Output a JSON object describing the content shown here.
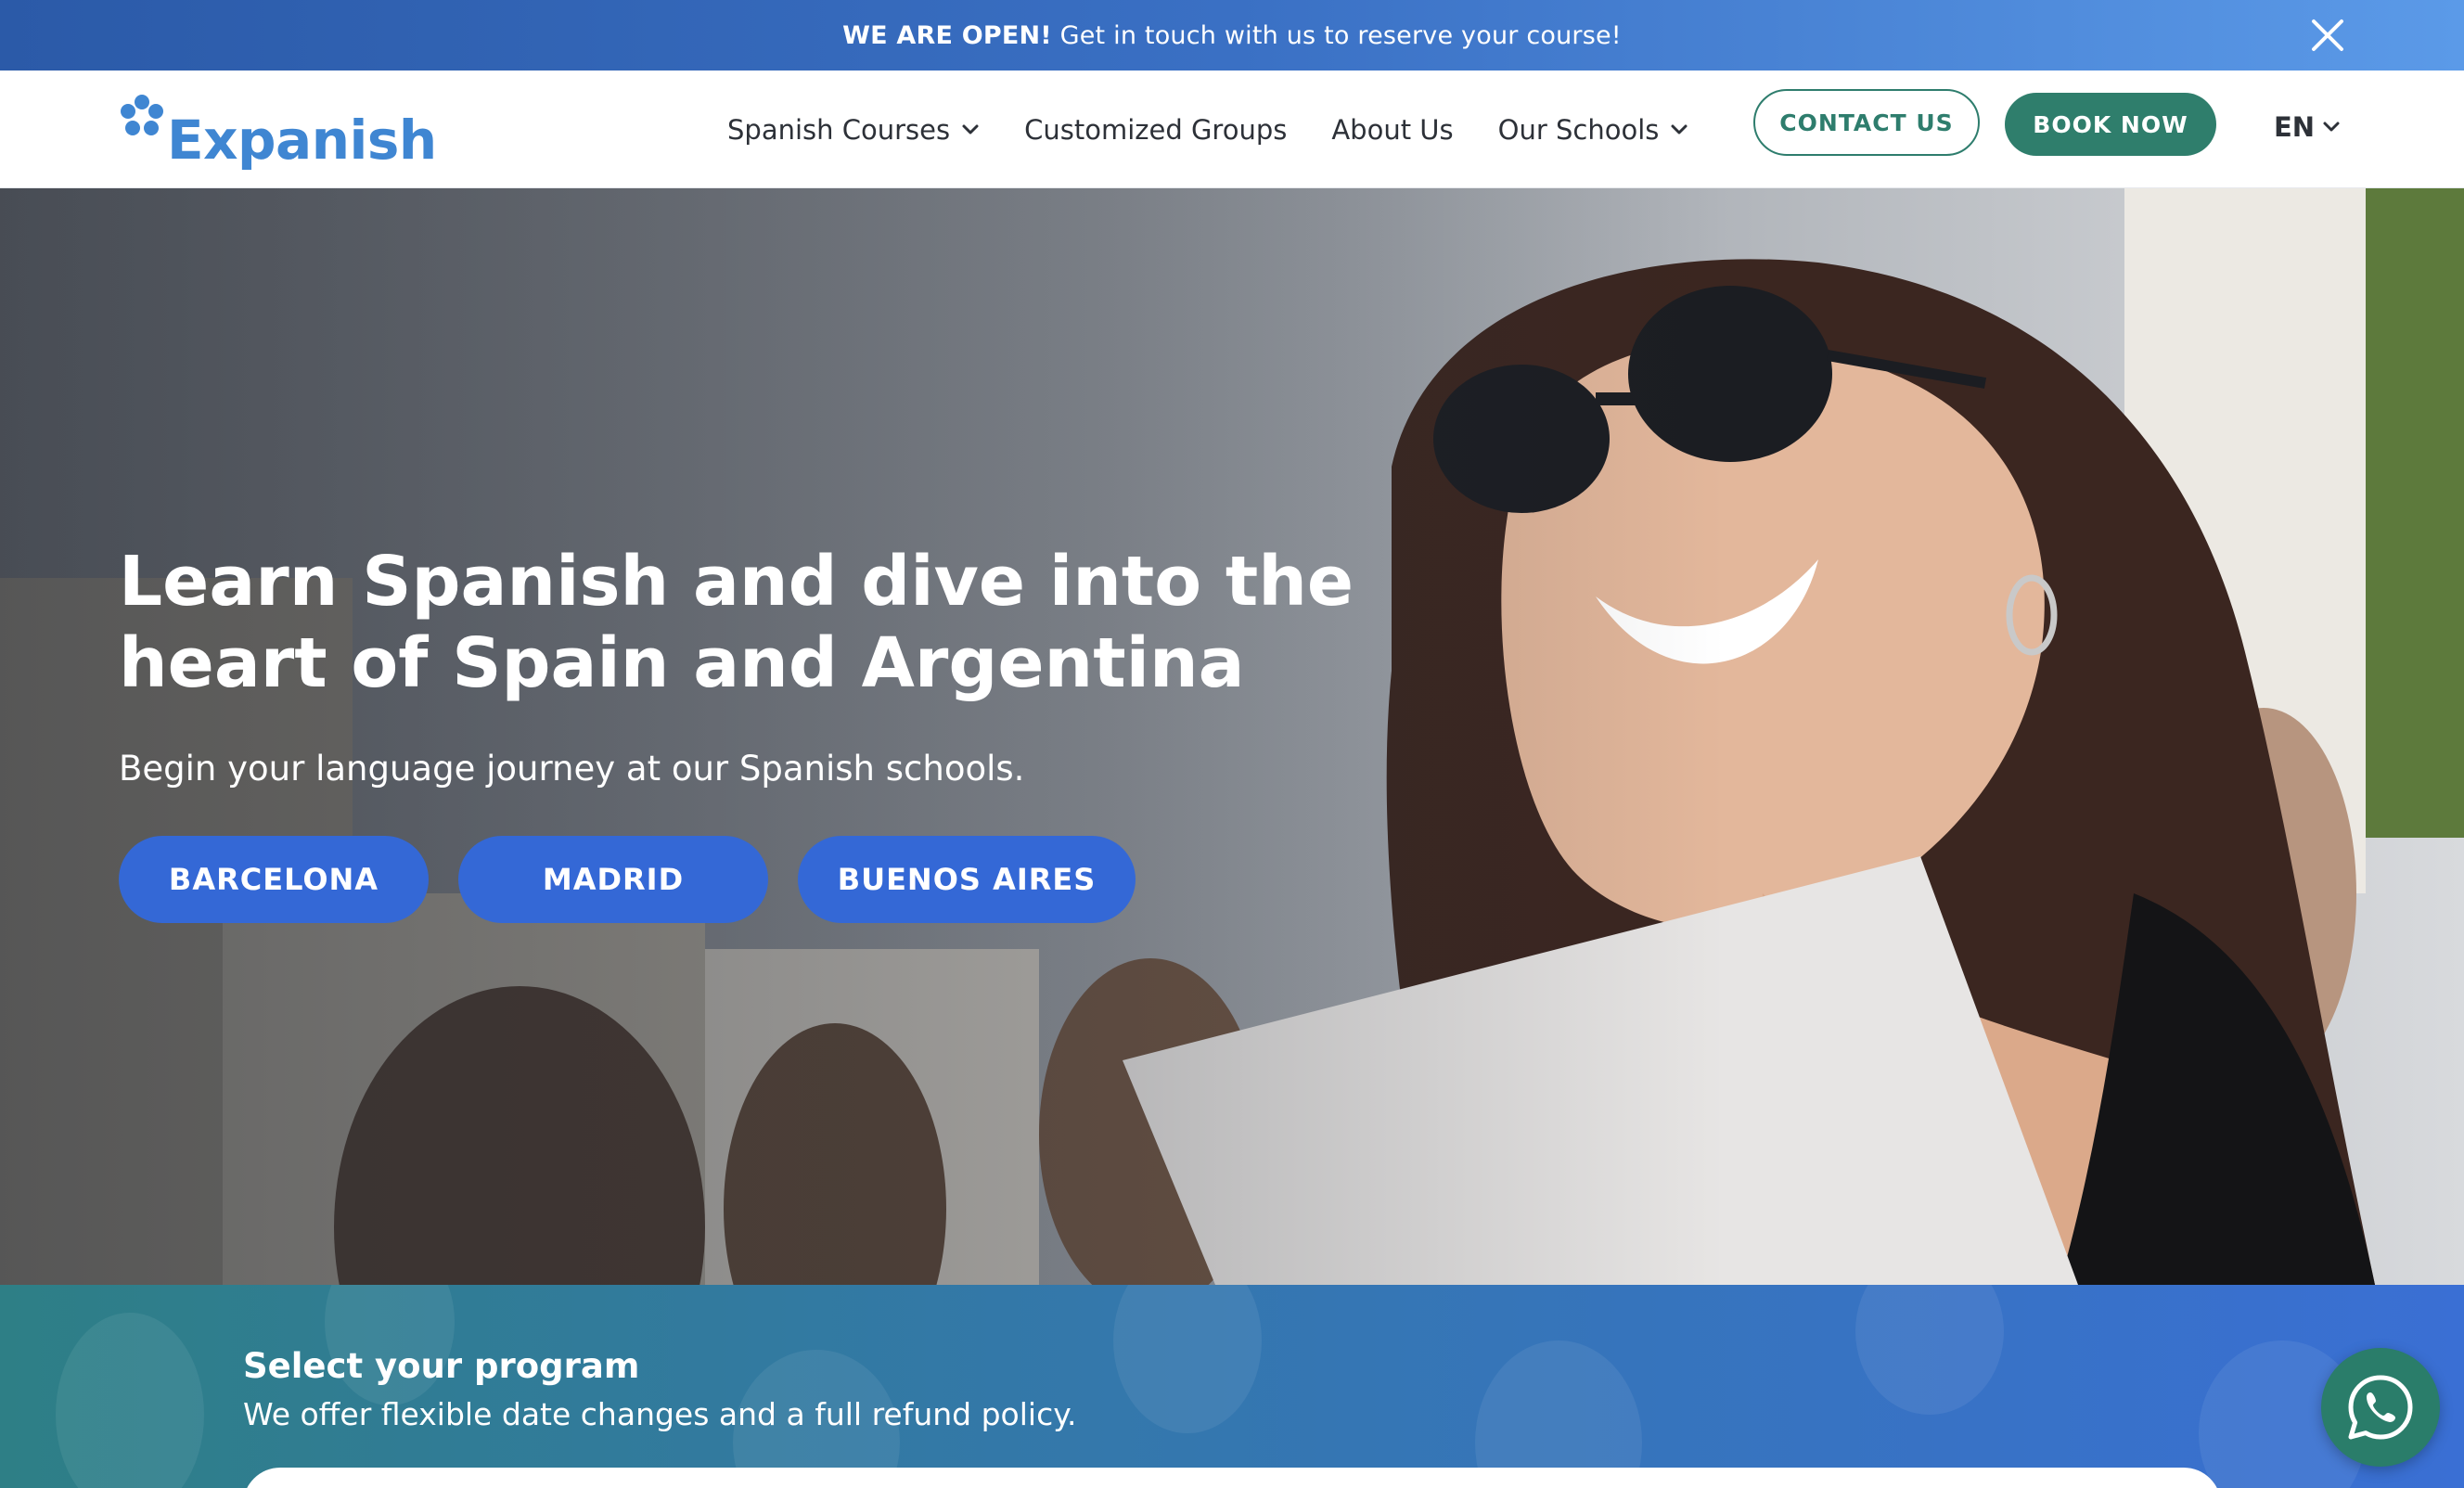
{
  "announcement": {
    "bold": "WE ARE OPEN!",
    "text": " Get in touch with us to reserve your course!"
  },
  "header": {
    "logo": "Expanish",
    "nav": [
      {
        "label": "Spanish Courses",
        "dropdown": true
      },
      {
        "label": "Customized Groups",
        "dropdown": false
      },
      {
        "label": "About Us",
        "dropdown": false
      },
      {
        "label": "Our Schools",
        "dropdown": true
      }
    ],
    "contact_label": "CONTACT US",
    "book_label": "BOOK NOW",
    "language": "EN"
  },
  "hero": {
    "title_line1": "Learn Spanish and dive into the",
    "title_line2": "heart of Spain and Argentina",
    "subtitle": "Begin your language journey at our Spanish schools.",
    "cities": [
      "BARCELONA",
      "MADRID",
      "BUENOS AIRES"
    ]
  },
  "program": {
    "title": "Select your program",
    "subtitle": "We offer flexible date changes and a full refund policy."
  },
  "colors": {
    "brand_blue": "#3f86d2",
    "brand_green": "#2f7e6c",
    "city_button": "#3468d6"
  },
  "icons": [
    "close-icon",
    "chevron-down-icon",
    "logo-flower-icon",
    "whatsapp-icon"
  ]
}
